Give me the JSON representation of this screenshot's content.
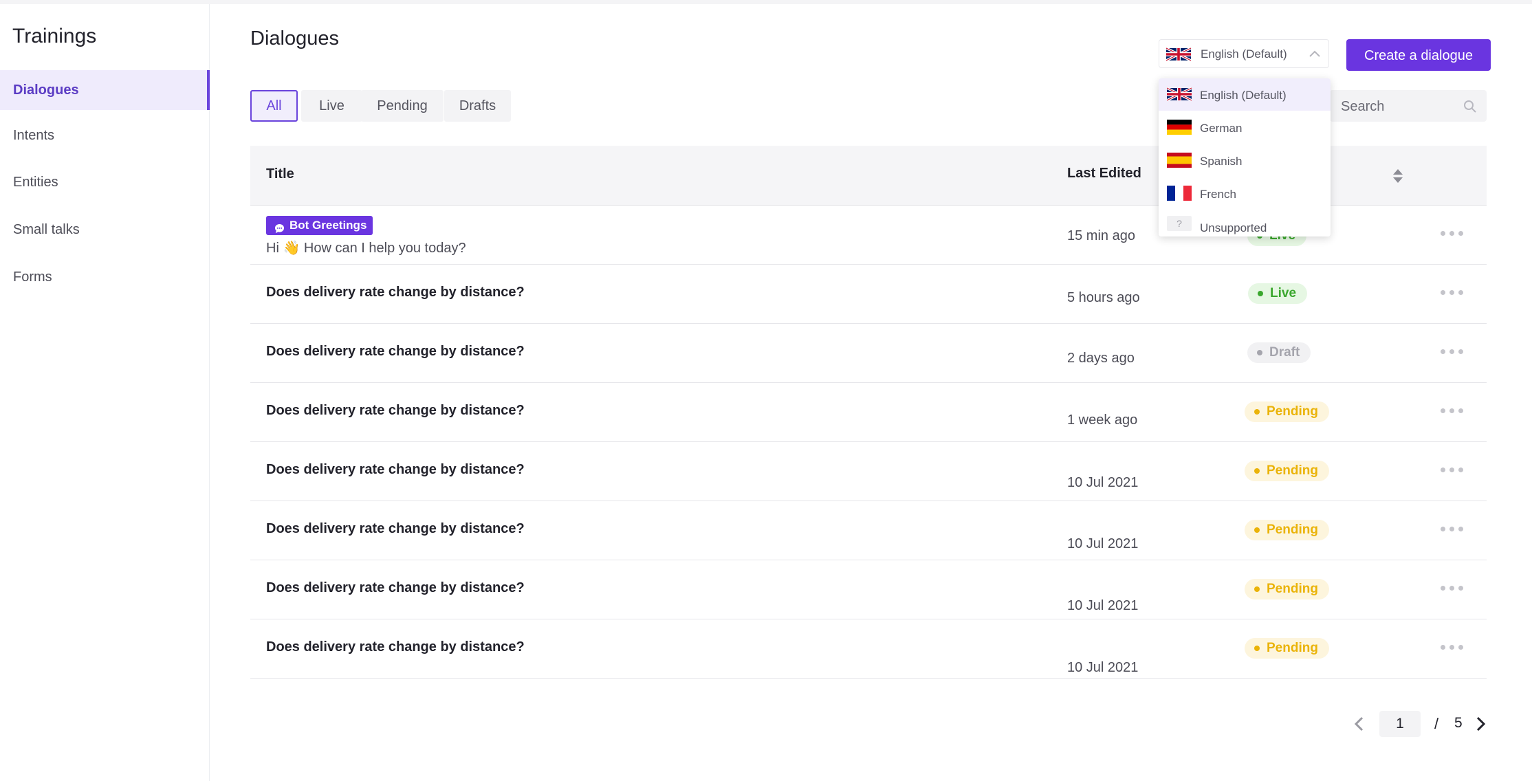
{
  "sidebar": {
    "title": "Trainings",
    "items": [
      {
        "label": "Dialogues",
        "active": true
      },
      {
        "label": "Intents"
      },
      {
        "label": "Entities"
      },
      {
        "label": "Small talks"
      },
      {
        "label": "Forms"
      }
    ]
  },
  "header": {
    "title": "Dialogues",
    "language_select": {
      "value": "English (Default)",
      "flag": "uk-flag-icon"
    },
    "create_button": "Create a dialogue"
  },
  "filters": {
    "tabs": [
      "All",
      "Live",
      "Pending",
      "Drafts"
    ],
    "active": "All"
  },
  "search": {
    "placeholder": "Search"
  },
  "table": {
    "columns": {
      "title": "Title",
      "last_edited": "Last Edited"
    },
    "rows": [
      {
        "tag": "Bot Greetings",
        "title": "Hi 👋 How can I help you today?",
        "last_edited": "15 min ago",
        "status": "Live"
      },
      {
        "title": "Does delivery rate change by distance?",
        "last_edited": "5 hours ago",
        "status": "Live"
      },
      {
        "title": "Does delivery rate change by distance?",
        "last_edited": "2 days ago",
        "status": "Draft"
      },
      {
        "title": "Does delivery rate change by distance?",
        "last_edited": "1 week ago",
        "status": "Pending"
      },
      {
        "title": "Does delivery rate change by distance?",
        "last_edited": "10 Jul 2021",
        "status": "Pending"
      },
      {
        "title": "Does delivery rate change by distance?",
        "last_edited": "10 Jul 2021",
        "status": "Pending"
      },
      {
        "title": "Does delivery rate change by distance?",
        "last_edited": "10 Jul 2021",
        "status": "Pending"
      },
      {
        "title": "Does delivery rate change by distance?",
        "last_edited": "10 Jul 2021",
        "status": "Pending"
      }
    ]
  },
  "pagination": {
    "current": "1",
    "separator": "/",
    "total": "5"
  },
  "language_menu": {
    "options": [
      {
        "label": "English (Default)",
        "flag": "uk-flag-icon",
        "selected": true
      },
      {
        "label": "German",
        "flag": "germany-flag-icon"
      },
      {
        "label": "Spanish",
        "flag": "spain-flag-icon"
      },
      {
        "label": "French",
        "flag": "france-flag-icon"
      },
      {
        "label": "Unsupported",
        "flag": "unsupported-flag-icon",
        "flag_text": "?"
      }
    ]
  },
  "colors": {
    "accent": "#6a35e0",
    "live": "#3aa72d",
    "pending": "#eab308",
    "draft": "#a5a5ad"
  }
}
